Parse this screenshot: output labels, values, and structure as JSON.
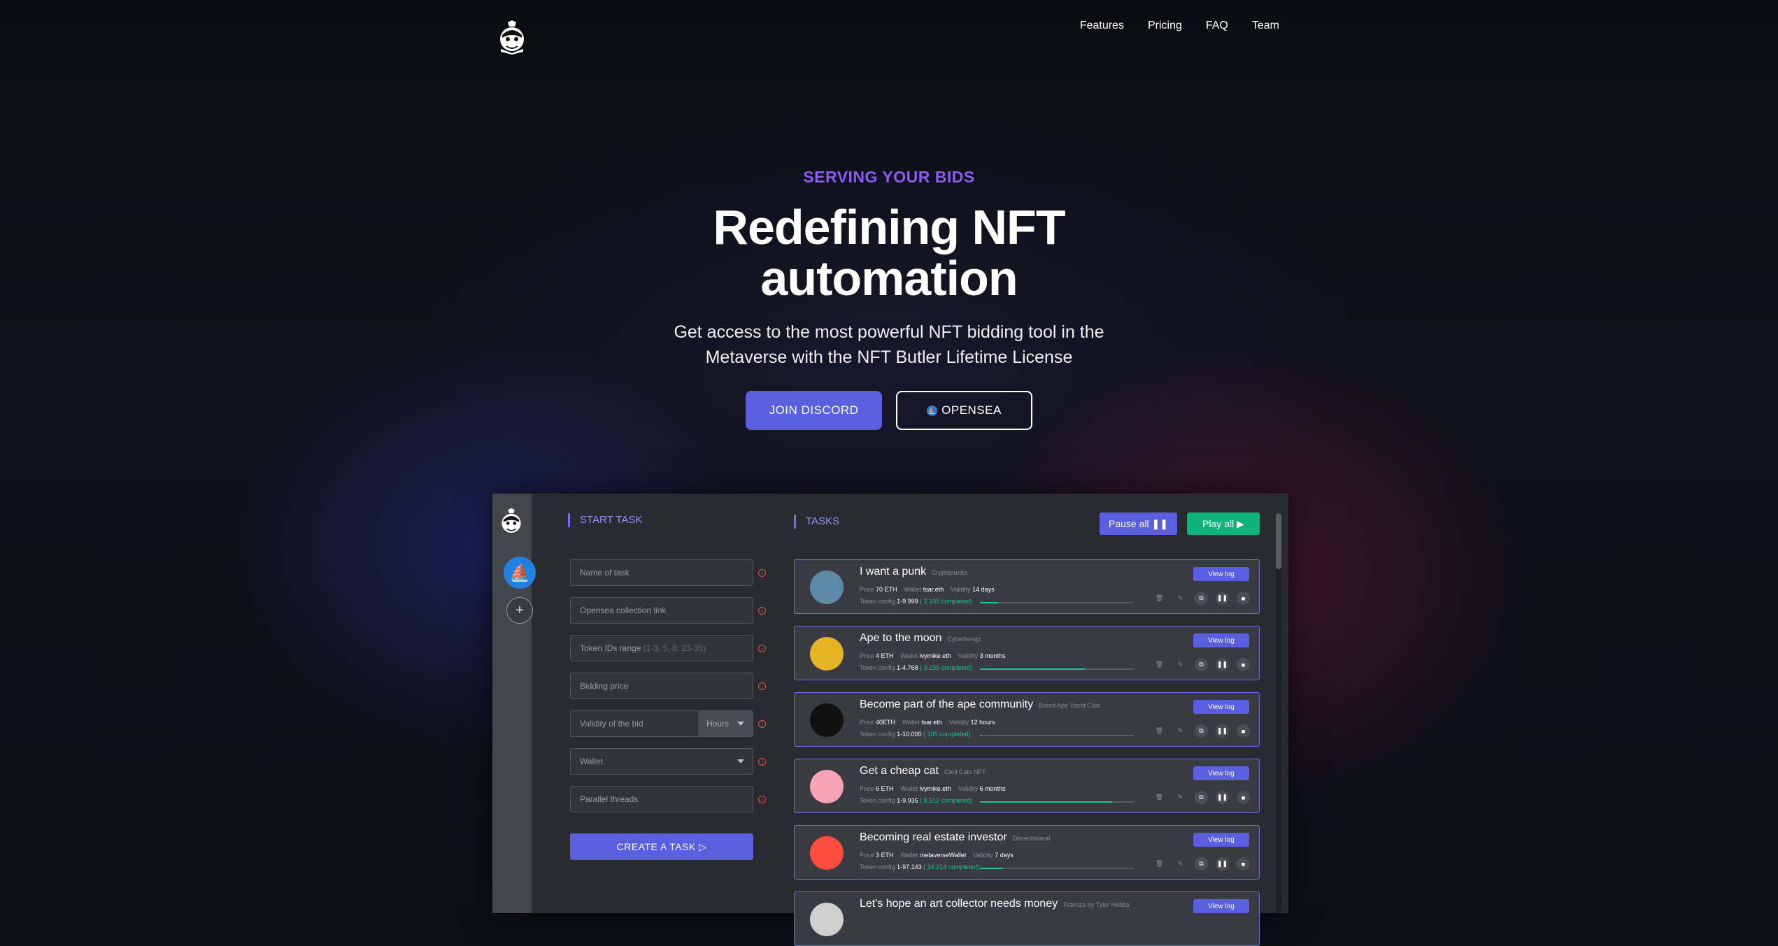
{
  "nav": {
    "logo_icon": "butler-logo-icon",
    "links": [
      "Features",
      "Pricing",
      "FAQ",
      "Team"
    ]
  },
  "hero": {
    "eyebrow": "SERVING YOUR BIDS",
    "headline_line1": "Redefining NFT",
    "headline_line2": "automation",
    "subtitle_line1": "Get access to the most powerful NFT bidding tool in the",
    "subtitle_line2": "Metaverse with the NFT Butler Lifetime License",
    "cta_discord": "JOIN DISCORD",
    "cta_opensea": "OPENSEA"
  },
  "colors": {
    "accent": "#5a5fe0",
    "eyebrow": "#8b5cf6",
    "success": "#0fb27a",
    "error": "#e0524f"
  },
  "app": {
    "start_task_title": "START TASK",
    "tasks_title": "TASKS",
    "pause_all": "Pause all",
    "play_all": "Play all",
    "form": {
      "task_name": "Name of task",
      "collection_link": "Opensea collection link",
      "token_range": "Token IDs range",
      "token_range_hint": "(1-3, 5, 8, 23-35)",
      "bidding_price": "Bidding price",
      "validity": "Validity of the bid",
      "validity_unit": "Hours",
      "wallet": "Wallet",
      "threads": "Parallel threads",
      "create_button": "CREATE A TASK"
    },
    "task_labels": {
      "price": "Price",
      "wallet": "Wallet",
      "validity": "Validity",
      "token_config": "Token config",
      "view_log": "View log"
    },
    "tasks": [
      {
        "title": "I want a punk",
        "collection": "Cryptopunks",
        "price": "70 ETH",
        "wallet": "tsar.eth",
        "validity": "14 days",
        "token_config": "1-9.999",
        "completed": "( 2.105 completed)",
        "progress": 0.12,
        "avatar_color": "#5d8aa8",
        "avatar_icon": "punk-avatar-icon"
      },
      {
        "title": "Ape to the moon",
        "collection": "Cyberkongz",
        "price": "4 ETH",
        "wallet": "ivymike.eth",
        "validity": "3 months",
        "token_config": "1-4.768",
        "completed": "( 3.235 completed)",
        "progress": 0.68,
        "avatar_color": "#e6b422",
        "avatar_icon": "kong-avatar-icon"
      },
      {
        "title": "Become part of the ape community",
        "collection": "Bored Ape Yacht Club",
        "price": "40ETH",
        "wallet": "tsar.eth",
        "validity": "12 hours",
        "token_config": "1-10.000",
        "completed": "( 105 completed)",
        "progress": 0.01,
        "avatar_color": "#111111",
        "avatar_icon": "bayc-avatar-icon"
      },
      {
        "title": "Get a cheap cat",
        "collection": "Cool Cats NFT",
        "price": "6 ETH",
        "wallet": "ivymike.eth",
        "validity": "6 months",
        "token_config": "1-9.935",
        "completed": "( 8.512 completed)",
        "progress": 0.86,
        "avatar_color": "#f7a3b5",
        "avatar_icon": "cat-avatar-icon"
      },
      {
        "title": "Becoming real estate investor",
        "collection": "Decentraland",
        "price": "3 ETH",
        "wallet": "metaverseWallet",
        "validity": "7 days",
        "token_config": "1-97.143",
        "completed": "( 14.214 completed)",
        "progress": 0.15,
        "avatar_color": "#ff4d3d",
        "avatar_icon": "decentraland-avatar-icon"
      },
      {
        "title": "Let's hope an art collector needs money",
        "collection": "Fidenza by Tyler Hobbs",
        "price": "",
        "wallet": "",
        "validity": "",
        "token_config": "",
        "completed": "",
        "progress": 0,
        "avatar_color": "#cfcfcf",
        "avatar_icon": "fidenza-avatar-icon"
      }
    ]
  }
}
